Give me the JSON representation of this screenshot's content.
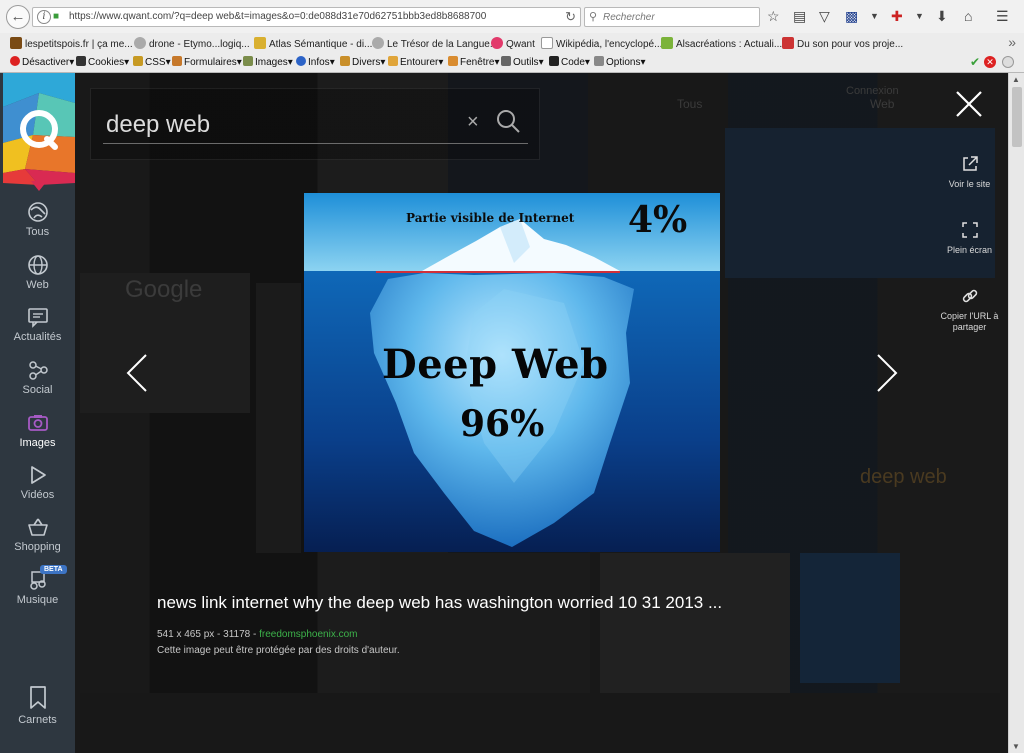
{
  "browser": {
    "url": "https://www.qwant.com/?q=deep web&t=images&o=0:de088d31e70d62751bbb3ed8b8688700",
    "search_placeholder": "Rechercher",
    "bookmarks": [
      "lespetitspois.fr | ça me...",
      "drone - Etymo...logiq...",
      "Atlas Sémantique - di...",
      "Le Trésor de la Langue...",
      "Qwant",
      "Wikipédia, l'encyclopé...",
      "Alsacréations : Actuali...",
      "Du son pour vos proje..."
    ],
    "dev_toolbar": [
      "Désactiver",
      "Cookies",
      "CSS",
      "Formulaires",
      "Images",
      "Infos",
      "Divers",
      "Entourer",
      "Fenêtre",
      "Outils",
      "Code",
      "Options"
    ]
  },
  "sidebar": {
    "items": [
      {
        "label": "Tous"
      },
      {
        "label": "Web"
      },
      {
        "label": "Actualités"
      },
      {
        "label": "Social"
      },
      {
        "label": "Images"
      },
      {
        "label": "Vidéos"
      },
      {
        "label": "Shopping"
      },
      {
        "label": "Musique",
        "badge": "BETA"
      },
      {
        "label": "Carnets"
      }
    ],
    "active": "Images"
  },
  "search": {
    "query": "deep web"
  },
  "background_hints": {
    "tous_label": "Tous",
    "web_label": "Web",
    "connexion": "Connexion",
    "left_text": "Google",
    "right_text": "deep web"
  },
  "viewer": {
    "image_text": {
      "top": "Partie visible de Internet",
      "top_pct": "4%",
      "main": "Deep Web",
      "main_pct": "96%"
    },
    "actions": [
      {
        "label": "Voir le site"
      },
      {
        "label": "Plein écran"
      },
      {
        "label": "Copier l'URL à partager"
      }
    ],
    "caption": "news link internet why the deep web has washington worried 10 31 2013 ...",
    "meta": "541 x 465 px - 31178 - ",
    "source": "freedomsphoenix.com",
    "copyright": "Cette image peut être protégée par des droits d'auteur."
  },
  "colors": {
    "sidebar_bg": "#2e3740",
    "active_icon": "#a65ac4",
    "source_link": "#3cb24a"
  }
}
